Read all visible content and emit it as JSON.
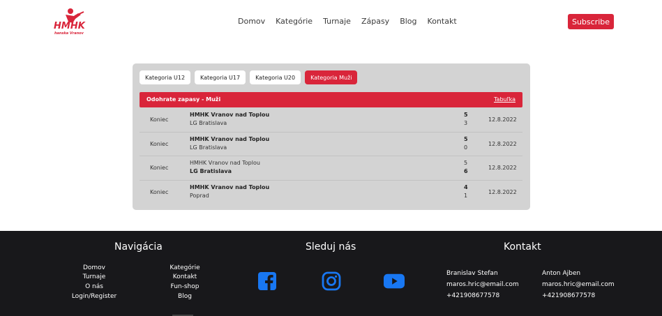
{
  "header": {
    "logo_text": "HMHK",
    "logo_subtext": "hanska Vranov",
    "nav": [
      "Domov",
      "Kategórie",
      "Turnaje",
      "Zápasy",
      "Blog",
      "Kontakt"
    ],
    "subscribe_label": "Subscribe"
  },
  "card": {
    "tabs": [
      "Kategoria U12",
      "Kategoria U17",
      "Kategoria U20",
      "Kategoria Muži"
    ],
    "active_tab": "Kategoria Muži",
    "section_title": "Odohrate zapasy - Muži",
    "section_link": "Tabuľka",
    "matches": [
      {
        "status": "Koniec",
        "team1": "HMHK Vranov nad Toplou",
        "team2": "LG Bratislava",
        "score1": "5",
        "score2": "3",
        "winner": 1,
        "date": "12.8.2022"
      },
      {
        "status": "Koniec",
        "team1": "HMHK Vranov nad Toplou",
        "team2": "LG Bratislava",
        "score1": "5",
        "score2": "0",
        "winner": 1,
        "date": "12.8.2022"
      },
      {
        "status": "Koniec",
        "team1": "HMHK Vranov nad Toplou",
        "team2": "LG Bratislava",
        "score1": "5",
        "score2": "6",
        "winner": 2,
        "date": "12.8.2022"
      },
      {
        "status": "Koniec",
        "team1": "HMHK Vranov nad Toplou",
        "team2": "Poprad",
        "score1": "4",
        "score2": "1",
        "winner": 1,
        "date": "12.8.2022"
      }
    ]
  },
  "footer": {
    "nav_heading": "Navigácia",
    "nav_col1": [
      "Domov",
      "Turnaje",
      "O nás",
      "Login/Register"
    ],
    "nav_col2": [
      "Kategórie",
      "Kontakt",
      "Fun-shop",
      "Blog"
    ],
    "social_heading": "Sleduj nás",
    "social_icons": [
      "facebook-icon",
      "instagram-icon",
      "youtube-icon"
    ],
    "contact_heading": "Kontakt",
    "contacts": [
      {
        "name": "Branislav Stefan",
        "email": "maros.hric@email.com",
        "phone": "+421908677578"
      },
      {
        "name": "Anton Ajben",
        "email": "maros.hric@email.com",
        "phone": "+421908677578"
      }
    ]
  },
  "colors": {
    "accent": "#d9253a",
    "card_bg": "#d3d3d3",
    "footer_bg": "#18181b",
    "social_blue": "#1877f2"
  }
}
